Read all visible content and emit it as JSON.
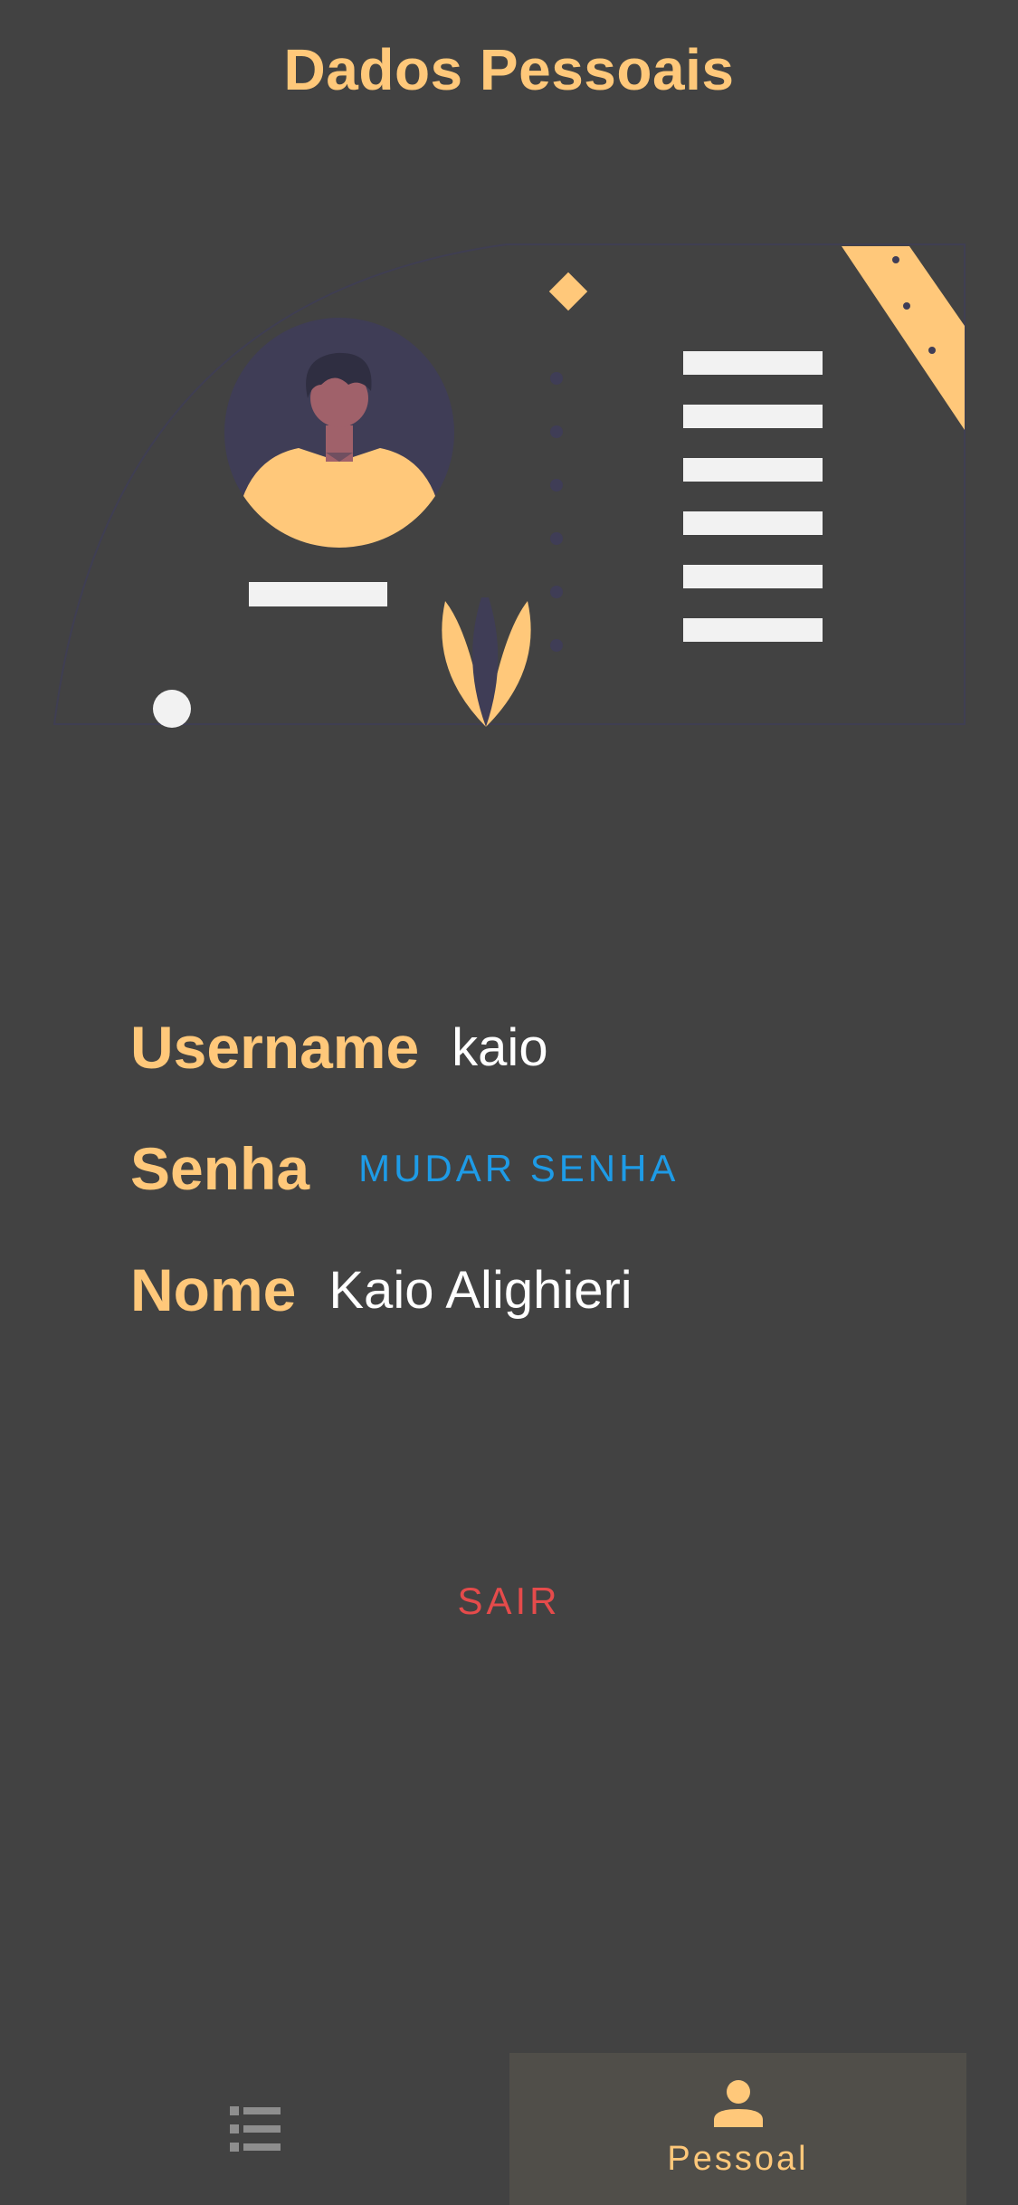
{
  "header": {
    "title": "Dados Pessoais"
  },
  "profile": {
    "username_label": "Username",
    "username_value": "kaio",
    "password_label": "Senha",
    "change_password_label": "MUDAR SENHA",
    "name_label": "Nome",
    "name_value": "Kaio Alighieri"
  },
  "actions": {
    "logout_label": "SAIR"
  },
  "bottom_nav": {
    "items": [
      {
        "icon": "list-icon",
        "label": "",
        "active": false
      },
      {
        "icon": "person-icon",
        "label": "Pessoal",
        "active": true
      }
    ]
  },
  "colors": {
    "background": "#424242",
    "accent": "#FFC87A",
    "link": "#1E9BE6",
    "danger": "#E54B4B",
    "active_tab": "#504E49",
    "illustration_dark": "#3F3D56"
  }
}
